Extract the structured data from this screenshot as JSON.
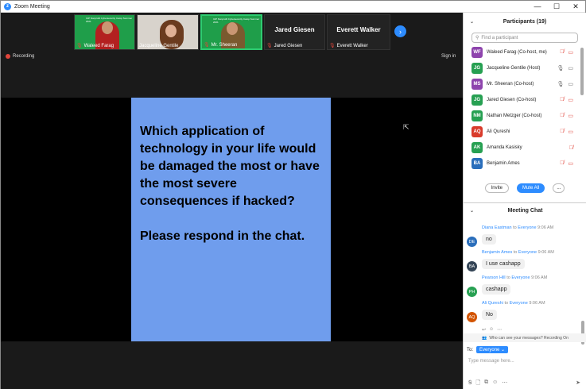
{
  "window": {
    "title": "Zoom Meeting",
    "controls": [
      "—",
      "☐",
      "✕"
    ]
  },
  "video_strip": [
    {
      "name": "Waleed Farag",
      "type": "video",
      "muted": true,
      "banner": "IUP Nonprofit Cybersecurity Camp Summer 2021"
    },
    {
      "name": "Jacqueline Gentile",
      "type": "video",
      "muted": false
    },
    {
      "name": "Mr. Sheeran",
      "type": "video",
      "muted": true,
      "banner": "IUP Nonprofit Cybersecurity Camp Summer 2021",
      "active": true
    },
    {
      "name": "Jared Giesen",
      "type": "name-only",
      "big_name": "Jared Giesen",
      "muted": true
    },
    {
      "name": "Everett Walker",
      "type": "name-only",
      "big_name": "Everett Walker",
      "muted": true
    }
  ],
  "recording_label": "Recording",
  "signin_label": "Sign in",
  "slide": {
    "question": "Which application of technology in your life would be damaged the most or have the most severe consequences if hacked?",
    "instruction": "Please respond in the chat."
  },
  "participants": {
    "header": "Participants (19)",
    "search_placeholder": "Find a participant",
    "list": [
      {
        "initials": "WF",
        "color": "#8e44ad",
        "name": "Waleed Farag (Co-host, me)",
        "mic": "muted",
        "video": "off"
      },
      {
        "initials": "JG",
        "color": "#27a052",
        "name": "Jacqueline Gentile (Host)",
        "mic": "on",
        "video": "on"
      },
      {
        "initials": "MS",
        "color": "#8e44ad",
        "name": "Mr. Sheeran (Co-host)",
        "mic": "on",
        "video": "on"
      },
      {
        "initials": "JG",
        "color": "#27a052",
        "name": "Jared Giesen (Co-host)",
        "mic": "muted",
        "video": "off"
      },
      {
        "initials": "NM",
        "color": "#27a052",
        "name": "Nathan Metzger (Co-host)",
        "mic": "muted",
        "video": "off"
      },
      {
        "initials": "AQ",
        "color": "#d93b2b",
        "name": "Ali Qureshi",
        "mic": "muted",
        "video": "off"
      },
      {
        "initials": "AK",
        "color": "#27a052",
        "name": "Amanda Kasisky",
        "mic": "muted",
        "video": ""
      },
      {
        "initials": "BA",
        "color": "#2a6ebb",
        "name": "Benjamin Ames",
        "mic": "muted",
        "video": "off"
      }
    ],
    "invite_label": "Invite",
    "mute_all_label": "Mute All",
    "more_label": "..."
  },
  "chat": {
    "header": "Meeting Chat",
    "messages": [
      {
        "initials": "DE",
        "color": "#2a6ebb",
        "sender": "Diana Eastman",
        "to": "to",
        "recipient": "Everyone",
        "time": "9:06 AM",
        "text": "no"
      },
      {
        "initials": "BA",
        "color": "#334455",
        "sender": "Benjamin Ames",
        "to": "to",
        "recipient": "Everyone",
        "time": "9:06 AM",
        "text": "I use cashapp"
      },
      {
        "initials": "PH",
        "color": "#27a052",
        "sender": "Pearson Hill",
        "to": "to",
        "recipient": "Everyone",
        "time": "9:06 AM",
        "text": "cashapp"
      },
      {
        "initials": "AQ",
        "color": "#d35400",
        "sender": "Ali Qureshi",
        "to": "to",
        "recipient": "Everyone",
        "time": "9:06 AM",
        "text": "No"
      }
    ],
    "who_can_see": "Who can see your messages? Recording On",
    "to_label": "To:",
    "to_value": "Everyone",
    "input_placeholder": "Type message here..."
  }
}
